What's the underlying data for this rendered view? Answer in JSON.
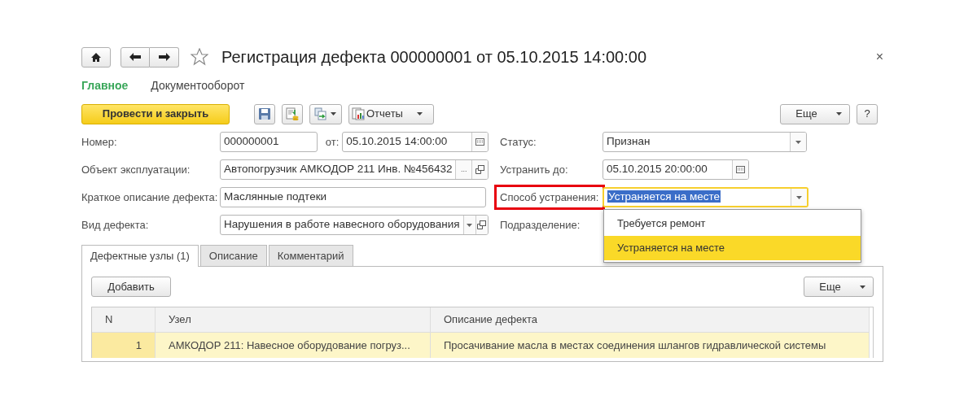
{
  "window": {
    "title": "Регистрация дефекта 000000001 от 05.10.2015 14:00:00",
    "close": "×"
  },
  "sections": [
    {
      "label": "Главное",
      "selected": true
    },
    {
      "label": "Документооборот",
      "selected": false
    }
  ],
  "toolbar": {
    "primary": "Провести и закрыть",
    "reports": "Отчеты",
    "more": "Еще",
    "help": "?"
  },
  "rows": [
    {
      "left": {
        "label": "Номер:",
        "kind": "number_date",
        "value": "000000001",
        "date_label": "от:",
        "date_value": "05.10.2015 14:00:00"
      },
      "right": {
        "label": "Статус:",
        "kind": "select",
        "value": "Признан"
      }
    },
    {
      "left": {
        "label": "Объект эксплуатации:",
        "kind": "ref",
        "value": "Автопогрузчик АМКОДОР 211 Инв. №456432",
        "select_button": "..."
      },
      "right": {
        "label": "Устранить до:",
        "kind": "date",
        "value": "05.10.2015 20:00:00"
      }
    },
    {
      "left": {
        "label": "Краткое описание дефекта:",
        "kind": "text",
        "value": "Маслянные подтеки"
      },
      "right": {
        "label": "Способ устранения:",
        "kind": "select",
        "value": "Устраняется на месте",
        "highlighted": true,
        "focused": true,
        "text_selected": true,
        "dropdown": [
          {
            "label": "Требуется ремонт",
            "selected": false
          },
          {
            "label": "Устраняется на месте",
            "selected": true
          }
        ]
      }
    },
    {
      "left": {
        "label": "Вид дефекта:",
        "kind": "select_ref",
        "value": "Нарушения в работе навесного оборудования"
      },
      "right": {
        "label": "Подразделение:",
        "kind": "covered"
      }
    }
  ],
  "tabs": [
    {
      "label": "Дефектные узлы (1)",
      "selected": true
    },
    {
      "label": "Описание",
      "selected": false
    },
    {
      "label": "Комментарий",
      "selected": false
    }
  ],
  "table_toolbar": {
    "add": "Добавить",
    "more": "Еще"
  },
  "table": {
    "columns": [
      "N",
      "Узел",
      "Описание дефекта"
    ],
    "rows": [
      {
        "cells": [
          "1",
          "АМКОДОР 211: Навесное оборудование погруз...",
          "Просачивание масла в местах соединения шлангов гидравлической системы"
        ],
        "selected": true
      }
    ]
  }
}
